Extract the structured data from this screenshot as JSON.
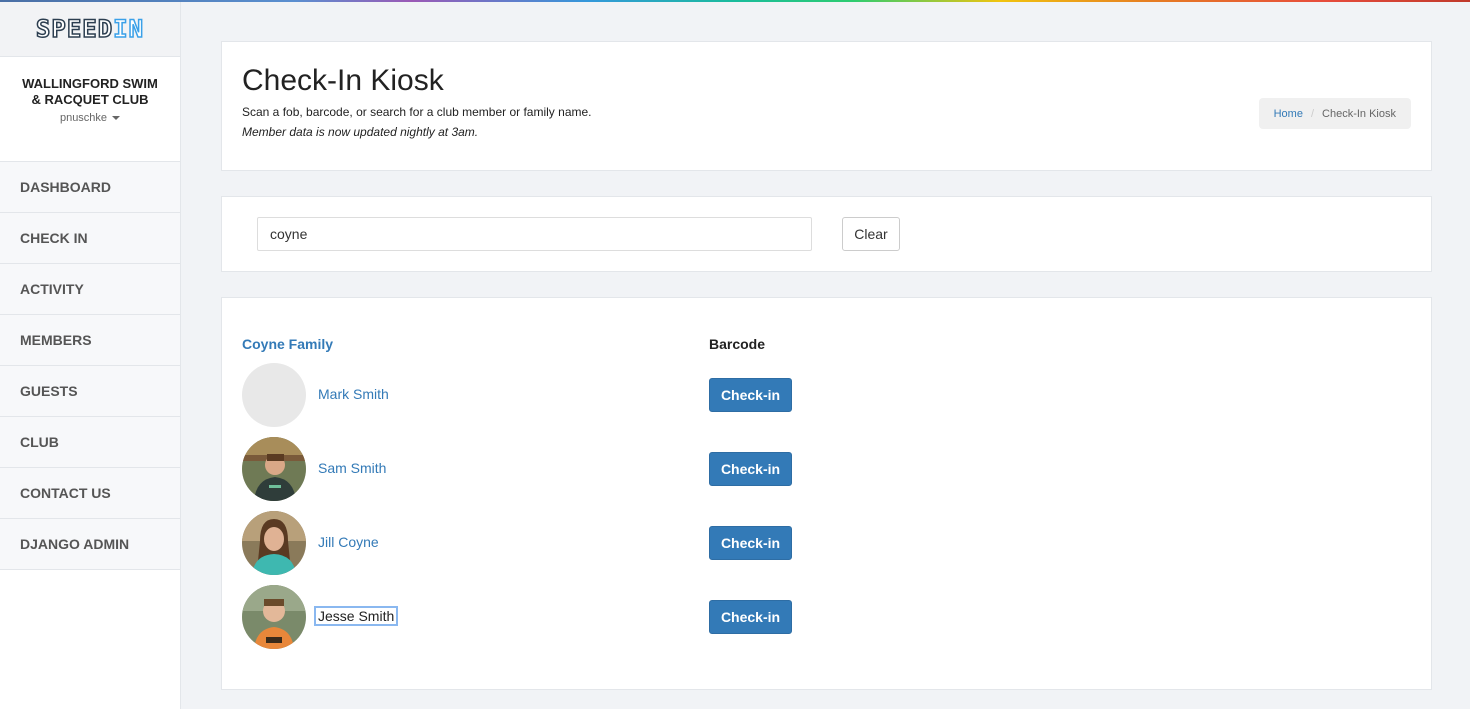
{
  "app": {
    "logo": "SPEEDIN"
  },
  "sidebar": {
    "club_name": "WALLINGFORD SWIM & RACQUET CLUB",
    "username": "pnuschke",
    "items": [
      {
        "label": "DASHBOARD"
      },
      {
        "label": "CHECK IN"
      },
      {
        "label": "ACTIVITY"
      },
      {
        "label": "MEMBERS"
      },
      {
        "label": "GUESTS"
      },
      {
        "label": "CLUB"
      },
      {
        "label": "CONTACT US"
      },
      {
        "label": "DJANGO ADMIN"
      }
    ]
  },
  "header": {
    "title": "Check-In Kiosk",
    "subtitle": "Scan a fob, barcode, or search for a club member or family name.",
    "note": "Member data is now updated nightly at 3am.",
    "breadcrumb": {
      "home": "Home",
      "separator": "/",
      "current": "Check-In Kiosk"
    }
  },
  "search": {
    "value": "coyne",
    "clear_label": "Clear"
  },
  "results": {
    "family_name": "Coyne Family",
    "barcode_header": "Barcode",
    "checkin_label": "Check-in",
    "members": [
      {
        "name": "Mark Smith"
      },
      {
        "name": "Sam Smith"
      },
      {
        "name": "Jill Coyne"
      },
      {
        "name": "Jesse Smith"
      }
    ]
  }
}
